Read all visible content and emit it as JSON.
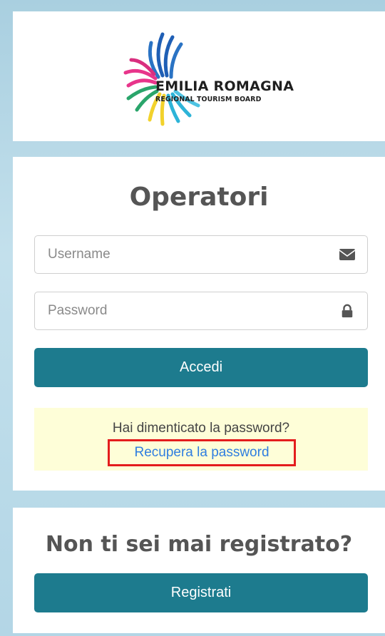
{
  "logo": {
    "title": "EMILIA ROMAGNA",
    "subtitle": "REGIONAL TOURISM BOARD",
    "icon": "sunburst-logo-icon",
    "colors": [
      "#1f5fb5",
      "#e8358b",
      "#2aa56b",
      "#f2d22c",
      "#2db4d8"
    ]
  },
  "login": {
    "title": "Operatori",
    "username_placeholder": "Username",
    "username_icon": "envelope-icon",
    "password_placeholder": "Password",
    "password_icon": "lock-icon",
    "submit_label": "Accedi"
  },
  "forgot": {
    "question": "Hai dimenticato la password?",
    "link_label": "Recupera la password"
  },
  "register": {
    "title": "Non ti sei mai registrato?",
    "button_label": "Registrati"
  },
  "colors": {
    "button": "#1d7b8e",
    "link": "#2f7ee0",
    "highlight_border": "#e41d1d",
    "notice_bg": "#fefed8",
    "background": "#b3d6e6"
  }
}
